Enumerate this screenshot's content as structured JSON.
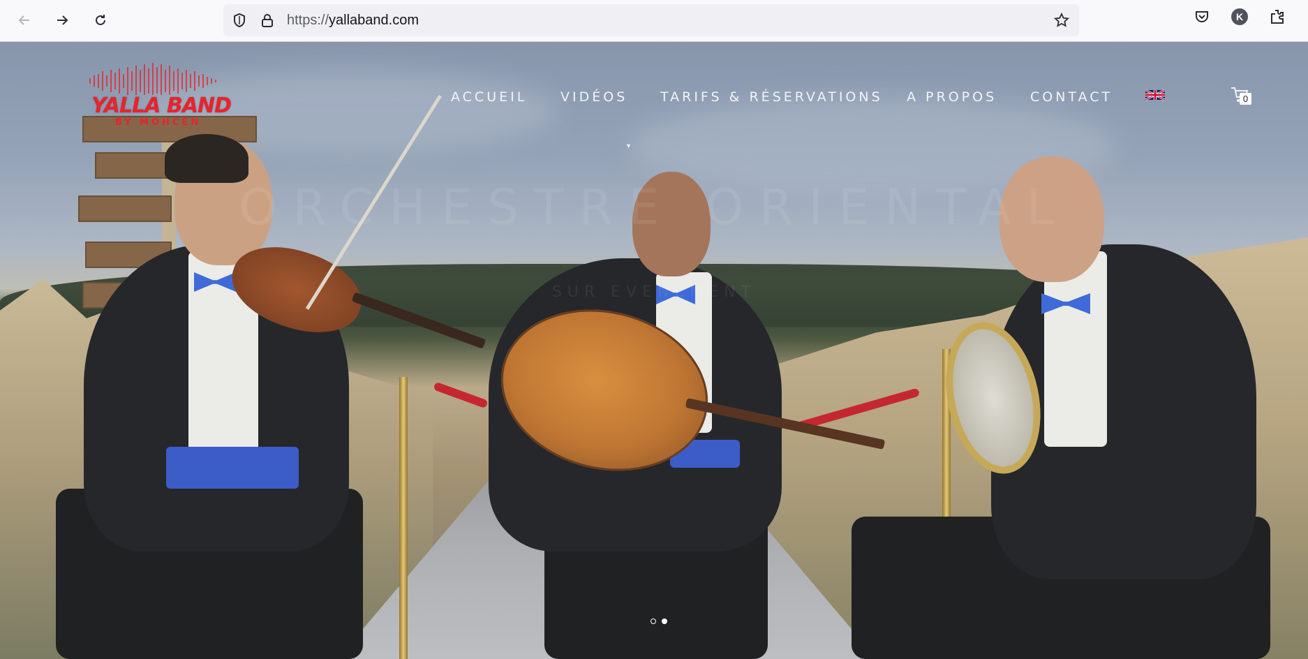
{
  "browser": {
    "url_protocol": "https://",
    "url_host": "yallaband.com",
    "icons": [
      "back-icon",
      "forward-icon",
      "reload-icon",
      "shield-icon",
      "lock-icon",
      "star-icon",
      "pocket-icon",
      "account-icon",
      "extensions-icon"
    ],
    "account_initial": "K"
  },
  "site": {
    "logo_title": "YALLA BAND",
    "logo_sub": "BY MOHCEN",
    "menu": [
      {
        "label": "ACCUEIL"
      },
      {
        "label": "VIDÉOS",
        "has_dropdown": true
      },
      {
        "label": "TARIFS & RÉSERVATIONS"
      },
      {
        "label": "A PROPOS"
      },
      {
        "label": "CONTACT"
      }
    ],
    "language_flag": "uk-flag-icon",
    "cart_count": "0"
  },
  "hero": {
    "title": "ORCHESTRE ORIENTAL",
    "subtitle": "SUR EVENEMENT",
    "slides_total": 2,
    "active_slide": 2
  },
  "colors": {
    "brand_red": "#e8232c",
    "menu_text": "#f2f4f7",
    "bowtie_blue": "#2f5fd6"
  }
}
